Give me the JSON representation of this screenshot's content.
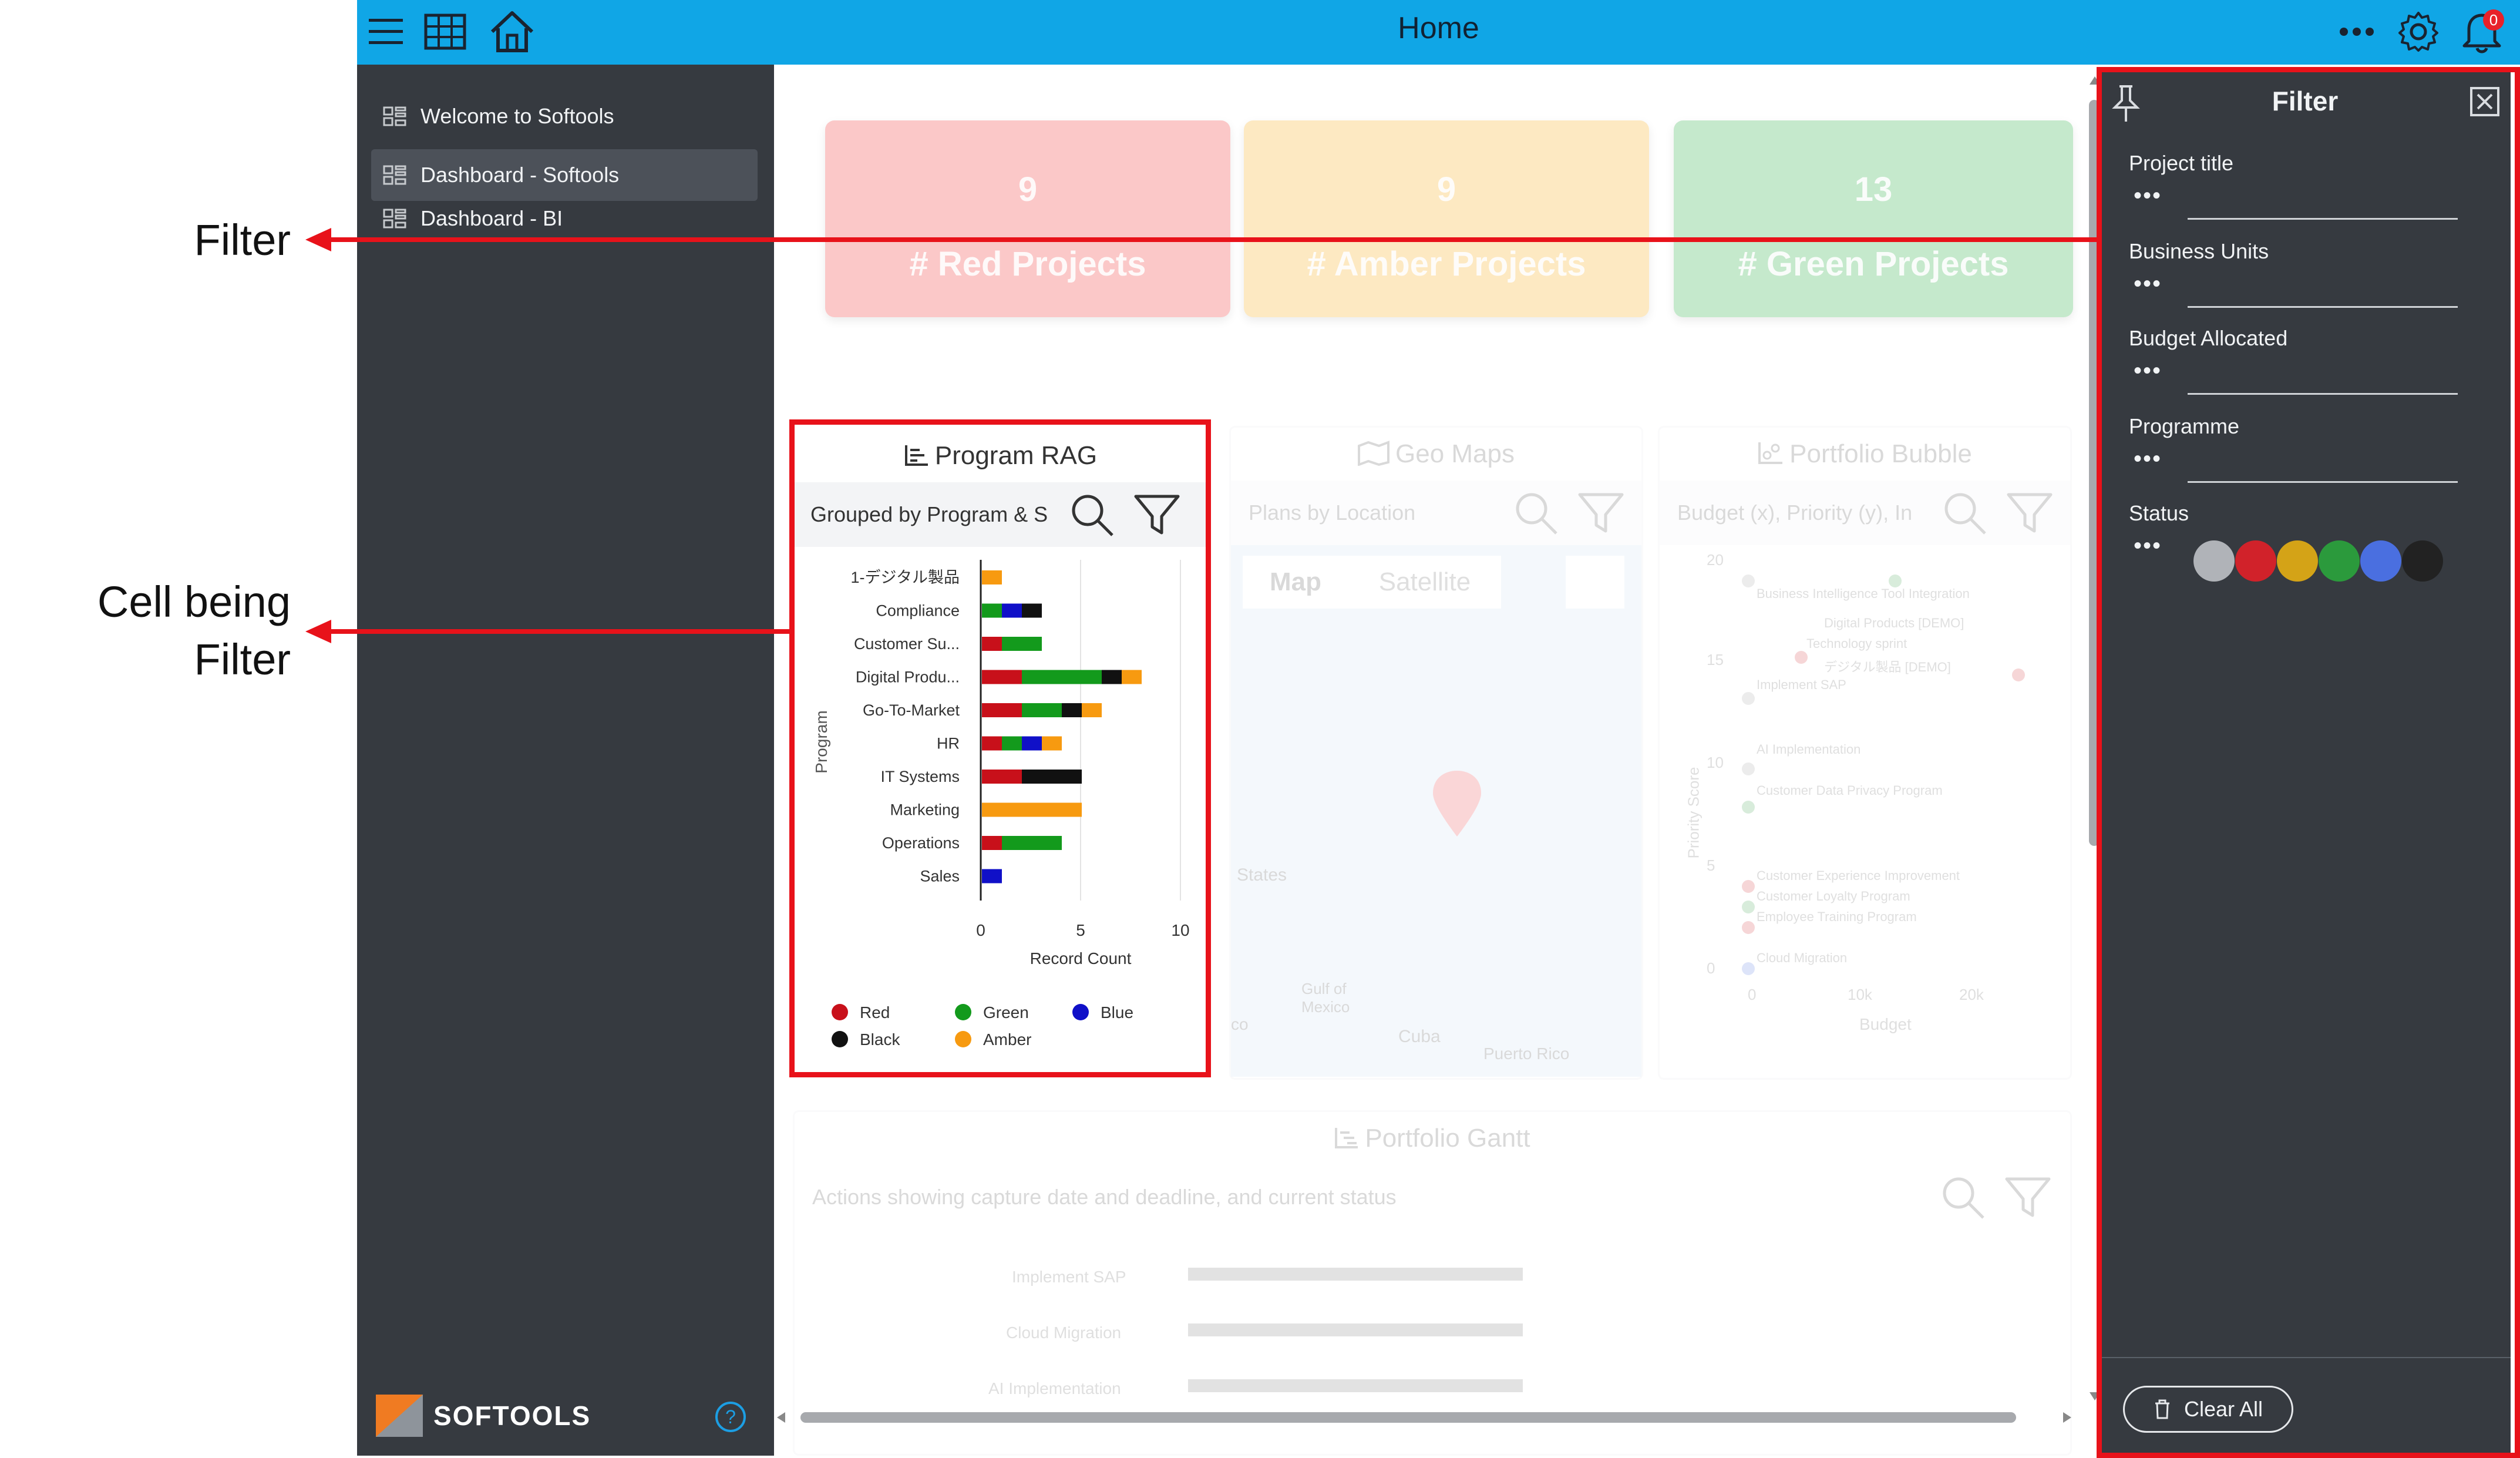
{
  "annotations": {
    "filter_label": "Filter",
    "cell_label_line1": "Cell being",
    "cell_label_line2": "Filter"
  },
  "topbar": {
    "title": "Home",
    "notification_count": "0",
    "color": "#10a6e6"
  },
  "sidebar": {
    "items": [
      {
        "label": "Welcome to Softools"
      },
      {
        "label": "Dashboard - Softools"
      },
      {
        "label": "Dashboard - BI"
      }
    ],
    "brand": "SOFTOOLS",
    "help": "?"
  },
  "kpis": [
    {
      "value": "9",
      "label": "# Red Projects",
      "color": "#f8a9a9"
    },
    {
      "value": "9",
      "label": "# Amber Projects",
      "color": "#fde8b0"
    },
    {
      "value": "13",
      "label": "# Green Projects",
      "color": "#a6dfb0"
    }
  ],
  "cards": {
    "program_rag": {
      "title": "Program RAG",
      "subtitle": "Grouped by Program & S"
    },
    "geo_maps": {
      "title": "Geo Maps",
      "subtitle": "Plans by Location",
      "map_tab": "Map",
      "satellite_tab": "Satellite"
    },
    "portfolio_bubble": {
      "title": "Portfolio Bubble",
      "subtitle": "Budget (x), Priority (y), In"
    },
    "portfolio_gantt": {
      "title": "Portfolio Gantt",
      "subtitle": "Actions showing capture date and deadline, and current status"
    }
  },
  "map_labels": [
    "States",
    "Gulf of Mexico",
    "Cuba",
    "Puerto Rico",
    "co"
  ],
  "bubble": {
    "ylabel": "Priority Score",
    "xlabel": "Budget",
    "yticks": [
      "20",
      "15",
      "10",
      "5",
      "0"
    ],
    "xticks": [
      "0",
      "10k",
      "20k"
    ],
    "labels": [
      "Business Intelligence Tool Integration",
      "Digital Products [DEMO]",
      "Technology sprint",
      "デジタル製品 [DEMO]",
      "Implement SAP",
      "AI Implementation",
      "Customer Data Privacy Program",
      "Customer Experience Improvement",
      "Customer Loyalty Program",
      "Employee Training Program",
      "Cloud Migration"
    ]
  },
  "gantt": {
    "rows": [
      "Implement SAP",
      "Cloud Migration",
      "AI Implementation"
    ]
  },
  "filter": {
    "title": "Filter",
    "fields": [
      {
        "label": "Project title",
        "value": "•••"
      },
      {
        "label": "Business Units",
        "value": "•••"
      },
      {
        "label": "Budget Allocated",
        "value": "•••"
      },
      {
        "label": "Programme",
        "value": "•••"
      },
      {
        "label": "Status",
        "value": "•••"
      }
    ],
    "status_colors": [
      "#b0b3b8",
      "#d1222a",
      "#d4a317",
      "#2b9a3c",
      "#4a6fe0",
      "#222222"
    ],
    "clear_all": "Clear All"
  },
  "chart_data": {
    "type": "bar",
    "orientation": "horizontal",
    "stacked": true,
    "ylabel": "Program",
    "xlabel": "Record Count",
    "xlim": [
      0,
      10
    ],
    "xticks": [
      "0",
      "5",
      "10"
    ],
    "categories": [
      "1-デジタル製品",
      "Compliance",
      "Customer Su...",
      "Digital Produ...",
      "Go-To-Market",
      "HR",
      "IT Systems",
      "Marketing",
      "Operations",
      "Sales"
    ],
    "series": [
      {
        "name": "Red",
        "color": "#c8101a",
        "values": [
          0,
          0,
          1,
          2,
          2,
          1,
          2,
          0,
          1,
          0
        ]
      },
      {
        "name": "Green",
        "color": "#139a1c",
        "values": [
          0,
          1,
          2,
          4,
          2,
          1,
          0,
          0,
          3,
          0
        ]
      },
      {
        "name": "Blue",
        "color": "#1010c8",
        "values": [
          0,
          1,
          0,
          0,
          0,
          1,
          0,
          0,
          0,
          1
        ]
      },
      {
        "name": "Black",
        "color": "#111111",
        "values": [
          0,
          1,
          0,
          1,
          1,
          0,
          3,
          0,
          0,
          0
        ]
      },
      {
        "name": "Amber",
        "color": "#f79a10",
        "values": [
          1,
          0,
          0,
          1,
          1,
          1,
          0,
          5,
          0,
          0
        ]
      }
    ],
    "legend": [
      "Red",
      "Green",
      "Blue",
      "Black",
      "Amber"
    ]
  }
}
